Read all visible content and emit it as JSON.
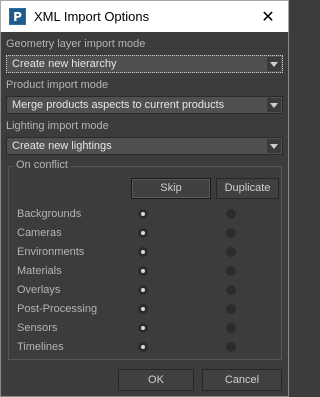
{
  "window": {
    "icon": "app-logo-icon",
    "icon_glyph": "P",
    "title": "XML Import Options",
    "close_glyph": "✕"
  },
  "geometry": {
    "label": "Geometry layer import mode",
    "value": "Create new hierarchy"
  },
  "product": {
    "label": "Product import mode",
    "value": "Merge products aspects to current products"
  },
  "lighting": {
    "label": "Lighting import mode",
    "value": "Create new lightings"
  },
  "conflict": {
    "title": "On conflict",
    "skip_label": "Skip",
    "duplicate_label": "Duplicate",
    "rows": [
      {
        "label": "Backgrounds",
        "selected": "skip"
      },
      {
        "label": "Cameras",
        "selected": "skip"
      },
      {
        "label": "Environments",
        "selected": "skip"
      },
      {
        "label": "Materials",
        "selected": "skip"
      },
      {
        "label": "Overlays",
        "selected": "skip"
      },
      {
        "label": "Post-Processing",
        "selected": "skip"
      },
      {
        "label": "Sensors",
        "selected": "skip"
      },
      {
        "label": "Timelines",
        "selected": "skip"
      }
    ]
  },
  "footer": {
    "ok_label": "OK",
    "cancel_label": "Cancel"
  }
}
